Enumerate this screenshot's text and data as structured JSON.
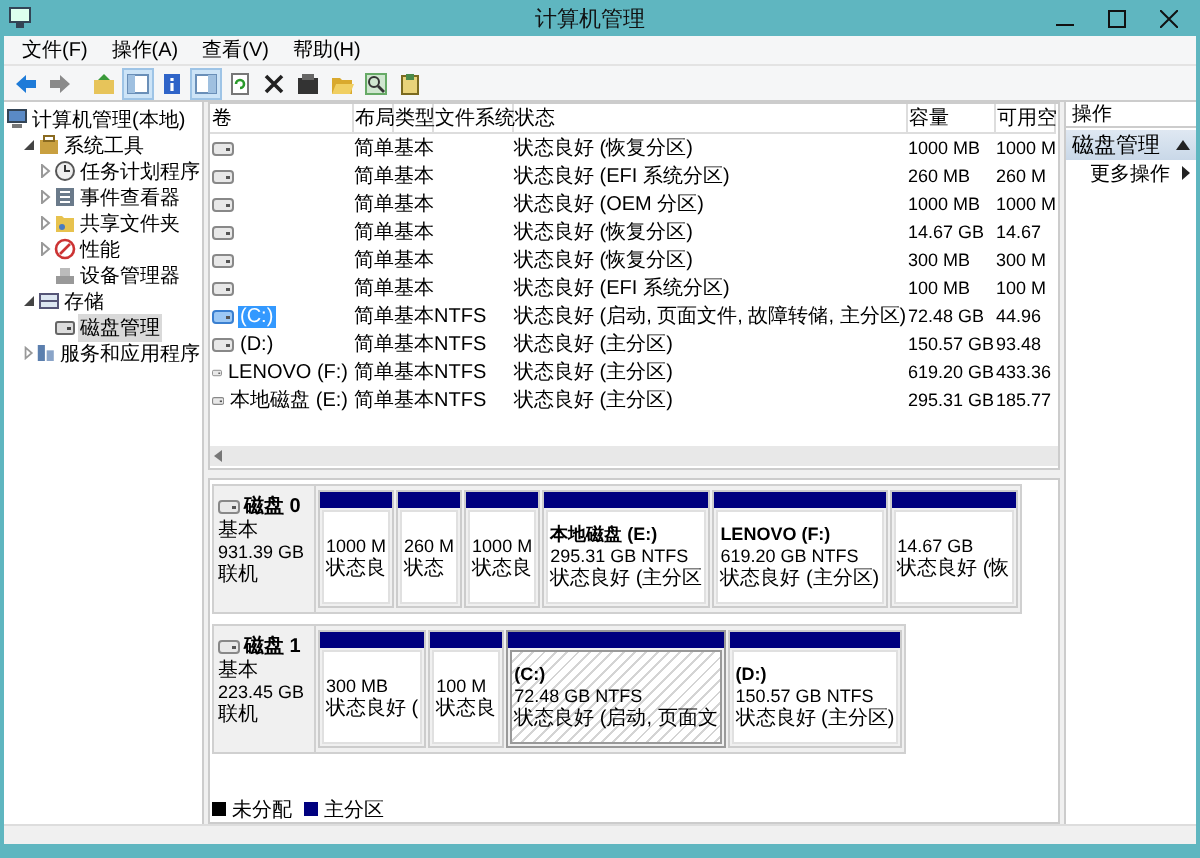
{
  "window": {
    "title": "计算机管理"
  },
  "menu": [
    "文件(F)",
    "操作(A)",
    "查看(V)",
    "帮助(H)"
  ],
  "toolbar": [
    {
      "kind": "back",
      "pressed": false
    },
    {
      "kind": "forward",
      "pressed": false
    },
    {
      "kind": "up",
      "pressed": false
    },
    {
      "kind": "tree",
      "pressed": true
    },
    {
      "kind": "help",
      "pressed": false
    },
    {
      "kind": "pane",
      "pressed": true
    },
    {
      "kind": "refresh",
      "pressed": false
    },
    {
      "kind": "delete",
      "pressed": false
    },
    {
      "kind": "properties",
      "pressed": false
    },
    {
      "kind": "open",
      "pressed": false
    },
    {
      "kind": "search",
      "pressed": false
    },
    {
      "kind": "settings",
      "pressed": false
    }
  ],
  "tree": [
    {
      "label": "计算机管理(本地)",
      "kind": "computer",
      "selected": false,
      "children": [
        {
          "label": "系统工具",
          "kind": "tools",
          "expanded": true,
          "selected": false,
          "children": [
            {
              "label": "任务计划程序",
              "kind": "clock",
              "expanded": false,
              "selected": false
            },
            {
              "label": "事件查看器",
              "kind": "log",
              "expanded": false,
              "selected": false
            },
            {
              "label": "共享文件夹",
              "kind": "folder",
              "expanded": false,
              "selected": false
            },
            {
              "label": "性能",
              "kind": "gauge",
              "expanded": false,
              "selected": false
            },
            {
              "label": "设备管理器",
              "kind": "device",
              "selected": false
            }
          ]
        },
        {
          "label": "存储",
          "kind": "storage",
          "expanded": true,
          "selected": false,
          "children": [
            {
              "label": "磁盘管理",
              "kind": "disk",
              "selected": true
            }
          ]
        },
        {
          "label": "服务和应用程序",
          "kind": "services",
          "expanded": false,
          "selected": false
        }
      ]
    }
  ],
  "table": {
    "columns": [
      "卷",
      "布局",
      "类型",
      "文件系统",
      "状态",
      "容量",
      "可用空"
    ],
    "rows": [
      {
        "layout": "简单",
        "type": "基本",
        "status": "状态良好 (恢复分区)",
        "capacity": "1000 MB",
        "free": "1000 M",
        "selected": false
      },
      {
        "layout": "简单",
        "type": "基本",
        "status": "状态良好 (EFI 系统分区)",
        "capacity": "260 MB",
        "free": "260 M",
        "selected": false
      },
      {
        "layout": "简单",
        "type": "基本",
        "status": "状态良好 (OEM 分区)",
        "capacity": "1000 MB",
        "free": "1000 M",
        "selected": false
      },
      {
        "layout": "简单",
        "type": "基本",
        "status": "状态良好 (恢复分区)",
        "capacity": "14.67 GB",
        "free": "14.67",
        "selected": false
      },
      {
        "layout": "简单",
        "type": "基本",
        "status": "状态良好 (恢复分区)",
        "capacity": "300 MB",
        "free": "300 M",
        "selected": false
      },
      {
        "layout": "简单",
        "type": "基本",
        "status": "状态良好 (EFI 系统分区)",
        "capacity": "100 MB",
        "free": "100 M",
        "selected": false
      },
      {
        "volume": "(C:)",
        "layout": "简单",
        "type": "基本",
        "fs": "NTFS",
        "status": "状态良好 (启动, 页面文件, 故障转储, 主分区)",
        "capacity": "72.48 GB",
        "free": "44.96",
        "selected": true
      },
      {
        "volume": "(D:)",
        "layout": "简单",
        "type": "基本",
        "fs": "NTFS",
        "status": "状态良好 (主分区)",
        "capacity": "150.57 GB",
        "free": "93.48",
        "selected": false
      },
      {
        "volume": "LENOVO (F:)",
        "layout": "简单",
        "type": "基本",
        "fs": "NTFS",
        "status": "状态良好 (主分区)",
        "capacity": "619.20 GB",
        "free": "433.36",
        "selected": false
      },
      {
        "volume": "本地磁盘 (E:)",
        "layout": "简单",
        "type": "基本",
        "fs": "NTFS",
        "status": "状态良好 (主分区)",
        "capacity": "295.31 GB",
        "free": "185.77",
        "selected": false
      }
    ]
  },
  "disks": [
    {
      "name": "磁盘 0",
      "type": "基本",
      "size": "931.39 GB",
      "status": "联机",
      "partitions": [
        {
          "lines": [
            "1000 M",
            "状态良"
          ],
          "selected": false
        },
        {
          "lines": [
            "260 M",
            "状态"
          ],
          "selected": false
        },
        {
          "lines": [
            "1000 M",
            "状态良"
          ],
          "selected": false
        },
        {
          "name": "本地磁盘 (E:)",
          "lines": [
            "295.31 GB NTFS",
            "状态良好 (主分区"
          ],
          "selected": false
        },
        {
          "name": "LENOVO (F:)",
          "lines": [
            "619.20 GB NTFS",
            "状态良好 (主分区)"
          ],
          "selected": false
        },
        {
          "lines": [
            "14.67 GB",
            "状态良好 (恢"
          ],
          "selected": false
        }
      ]
    },
    {
      "name": "磁盘 1",
      "type": "基本",
      "size": "223.45 GB",
      "status": "联机",
      "partitions": [
        {
          "lines": [
            "300 MB",
            "状态良好 ("
          ],
          "selected": false
        },
        {
          "lines": [
            "100 M",
            "状态良"
          ],
          "selected": false
        },
        {
          "name": "(C:)",
          "lines": [
            "72.48 GB NTFS",
            "状态良好 (启动, 页面文"
          ],
          "selected": true
        },
        {
          "name": "(D:)",
          "lines": [
            "150.57 GB NTFS",
            "状态良好 (主分区)"
          ],
          "selected": false
        }
      ]
    }
  ],
  "legend": [
    {
      "label": "未分配",
      "color": "#000000"
    },
    {
      "label": "主分区",
      "color": "#00007f"
    }
  ],
  "actions": {
    "title": "操作",
    "section": {
      "label": "磁盘管理",
      "expanded": true
    },
    "items": [
      "更多操作"
    ]
  }
}
